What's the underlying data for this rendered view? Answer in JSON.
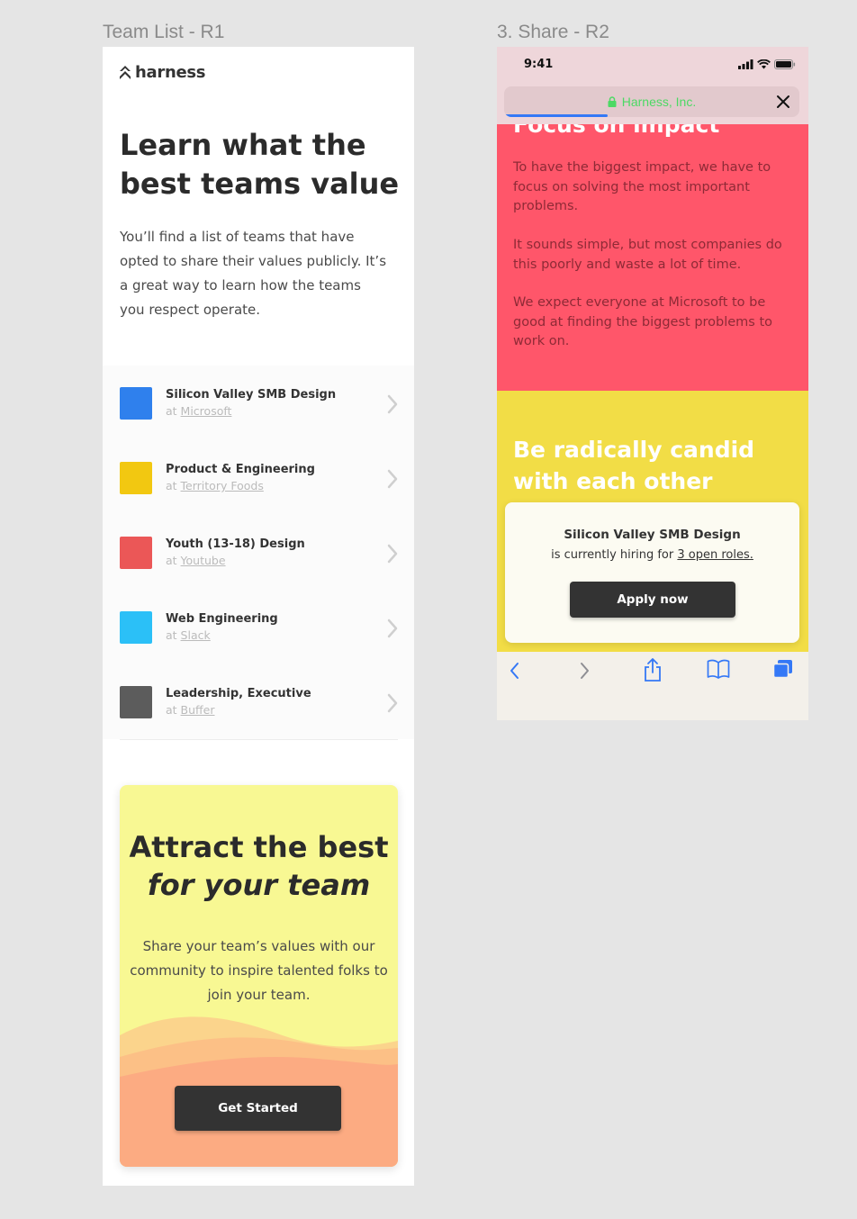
{
  "frames": {
    "team_list_label": "Team List - R1",
    "share_label": "3. Share - R2"
  },
  "brand": {
    "name": "harness"
  },
  "hero": {
    "title": "Learn what the best teams value",
    "description": "You’ll find a list of teams that have opted to share their values publicly. It’s a great way to learn how the teams you respect operate."
  },
  "teams": [
    {
      "name": "Silicon Valley SMB Design",
      "prefix": "at",
      "company": "Microsoft",
      "color": "#2f80ed"
    },
    {
      "name": "Product & Engineering",
      "prefix": "at",
      "company": "Territory Foods",
      "color": "#f2c811"
    },
    {
      "name": "Youth (13-18) Design",
      "prefix": "at",
      "company": "Youtube",
      "color": "#eb5757"
    },
    {
      "name": "Web Engineering",
      "prefix": "at",
      "company": "Slack",
      "color": "#2bc0f7"
    },
    {
      "name": "Leadership, Executive",
      "prefix": "at",
      "company": "Buffer",
      "color": "#5c5c5c"
    }
  ],
  "cta": {
    "title_line1": "Attract the best",
    "title_line2": "for your team",
    "description": "Share your team’s values with our community to inspire talented folks to join your team.",
    "button": "Get Started"
  },
  "share": {
    "status_time": "9:41",
    "url_text": "Harness, Inc.",
    "page_progress": 0.35,
    "red_heading": "Focus on impact",
    "red_paragraphs": [
      "To have the biggest impact, we have to focus on solving the most important problems.",
      "It sounds simple, but most companies do this poorly and waste a lot of time.",
      "We expect everyone at Microsoft to be good at finding the biggest problems to work on."
    ],
    "yellow_heading": "Be radically candid with each other",
    "hiring": {
      "team": "Silicon Valley SMB Design",
      "text_before": "is currently hiring for",
      "link": "3 open roles.",
      "button": "Apply now"
    }
  },
  "colors": {
    "red_section": "#ff566a",
    "yellow_section": "#f2dd46",
    "cta_card": "#f8f893",
    "url_green": "#4cd964",
    "ios_blue": "#3478f6"
  }
}
